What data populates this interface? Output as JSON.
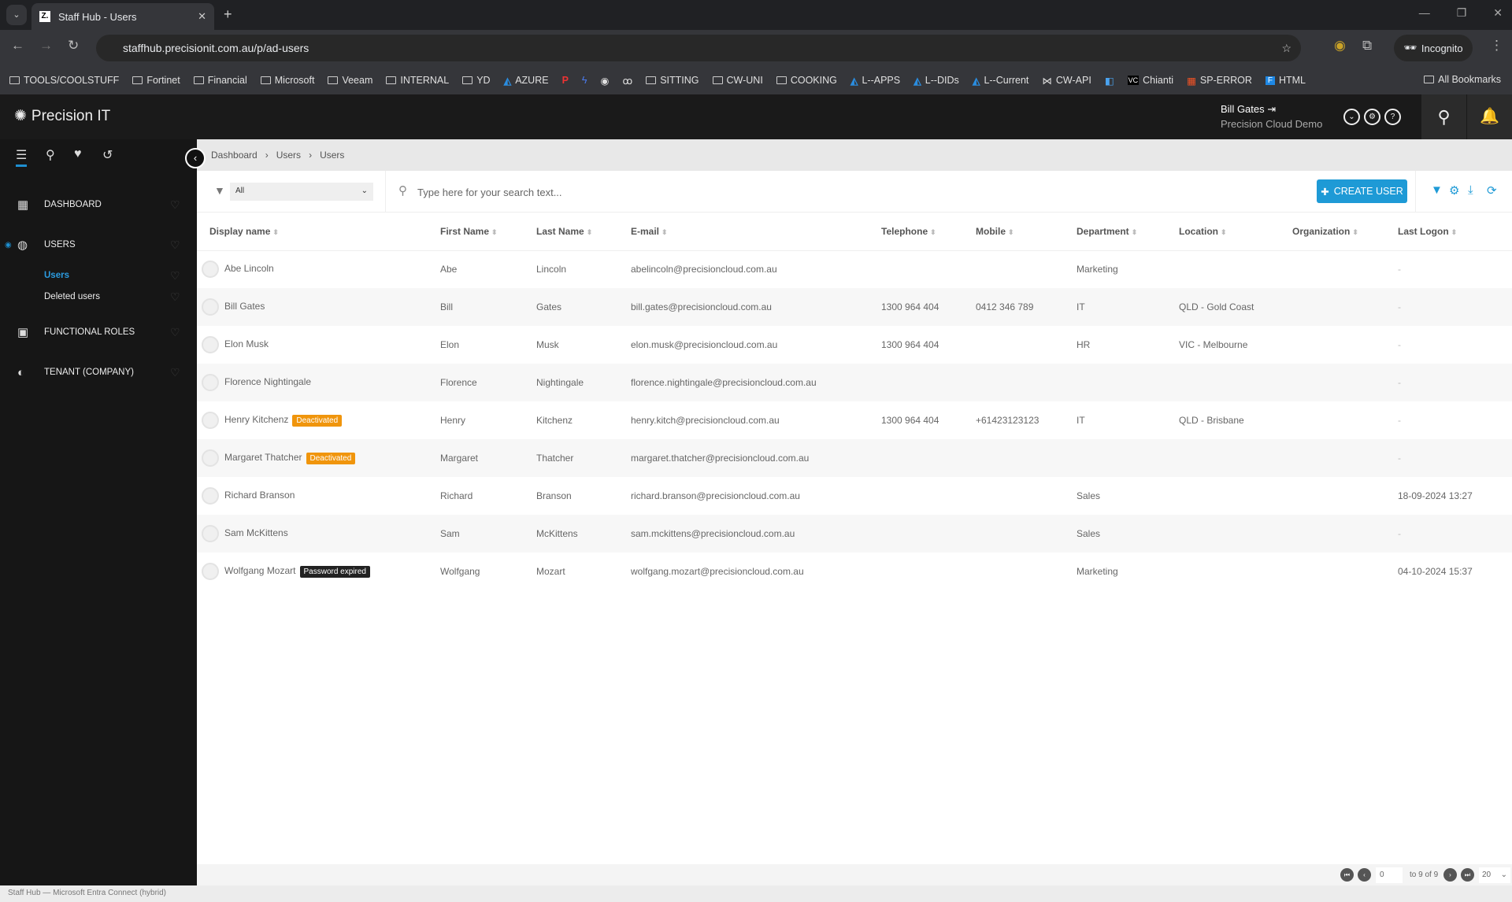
{
  "browser": {
    "tab_title": "Staff Hub - Users",
    "tab_favicon": "Z.",
    "url": "staffhub.precisionit.com.au/p/ad-users",
    "profile": "Incognito",
    "bookmarks": [
      {
        "label": "TOOLS/COOLSTUFF",
        "icon": "folder"
      },
      {
        "label": "Fortinet",
        "icon": "folder"
      },
      {
        "label": "Financial",
        "icon": "folder"
      },
      {
        "label": "Microsoft",
        "icon": "folder"
      },
      {
        "label": "Veeam",
        "icon": "folder"
      },
      {
        "label": "INTERNAL",
        "icon": "folder"
      },
      {
        "label": "YD",
        "icon": "folder"
      },
      {
        "label": "AZURE",
        "icon": "azure"
      },
      {
        "label": "",
        "icon": "red-p"
      },
      {
        "label": "",
        "icon": "bolt"
      },
      {
        "label": "",
        "icon": "globe"
      },
      {
        "label": "",
        "icon": "abc"
      },
      {
        "label": "SITTING",
        "icon": "folder"
      },
      {
        "label": "CW-UNI",
        "icon": "folder"
      },
      {
        "label": "COOKING",
        "icon": "folder"
      },
      {
        "label": "L--APPS",
        "icon": "azure"
      },
      {
        "label": "L--DIDs",
        "icon": "azure"
      },
      {
        "label": "L--Current",
        "icon": "azure"
      },
      {
        "label": "CW-API",
        "icon": "link"
      },
      {
        "label": "",
        "icon": "ai"
      },
      {
        "label": "Chianti",
        "icon": "vc"
      },
      {
        "label": "SP-ERROR",
        "icon": "ms"
      },
      {
        "label": "HTML",
        "icon": "f"
      }
    ],
    "all_bookmarks": "All Bookmarks"
  },
  "app": {
    "brand": "Precision IT",
    "user_name": "Bill Gates",
    "tenant": "Precision Cloud Demo"
  },
  "sidebar": {
    "items": [
      {
        "label": "DASHBOARD",
        "icon": "grid-icon"
      },
      {
        "label": "USERS",
        "icon": "user-icon"
      },
      {
        "label": "Users"
      },
      {
        "label": "Deleted users"
      },
      {
        "label": "FUNCTIONAL ROLES",
        "icon": "badge-icon"
      },
      {
        "label": "TENANT (COMPANY)",
        "icon": "compass-icon"
      }
    ]
  },
  "breadcrumb": [
    "Dashboard",
    "Users",
    "Users"
  ],
  "toolbar": {
    "filter_value": "All",
    "search_placeholder": "Type here for your search text...",
    "create_label": "CREATE USER"
  },
  "table": {
    "columns": [
      "Display name",
      "First Name",
      "Last Name",
      "E-mail",
      "Telephone",
      "Mobile",
      "Department",
      "Location",
      "Organization",
      "Last Logon"
    ],
    "rows": [
      {
        "display": "Abe Lincoln",
        "badge": "",
        "first": "Abe",
        "last": "Lincoln",
        "email": "abelincoln@precisioncloud.com.au",
        "tel": "",
        "mobile": "",
        "dept": "Marketing",
        "loc": "",
        "org": "",
        "logon": "-"
      },
      {
        "display": "Bill Gates",
        "badge": "",
        "first": "Bill",
        "last": "Gates",
        "email": "bill.gates@precisioncloud.com.au",
        "tel": "1300 964 404",
        "mobile": "0412 346 789",
        "dept": "IT",
        "loc": "QLD - Gold Coast",
        "org": "",
        "logon": "-"
      },
      {
        "display": "Elon Musk",
        "badge": "",
        "first": "Elon",
        "last": "Musk",
        "email": "elon.musk@precisioncloud.com.au",
        "tel": "1300 964 404",
        "mobile": "",
        "dept": "HR",
        "loc": "VIC - Melbourne",
        "org": "",
        "logon": "-"
      },
      {
        "display": "Florence Nightingale",
        "badge": "",
        "first": "Florence",
        "last": "Nightingale",
        "email": "florence.nightingale@precisioncloud.com.au",
        "tel": "",
        "mobile": "",
        "dept": "",
        "loc": "",
        "org": "",
        "logon": "-"
      },
      {
        "display": "Henry Kitchenz",
        "badge": "Deactivated",
        "first": "Henry",
        "last": "Kitchenz",
        "email": "henry.kitch@precisioncloud.com.au",
        "tel": "1300 964 404",
        "mobile": "+61423123123",
        "dept": "IT",
        "loc": "QLD - Brisbane",
        "org": "",
        "logon": "-"
      },
      {
        "display": "Margaret Thatcher",
        "badge": "Deactivated",
        "first": "Margaret",
        "last": "Thatcher",
        "email": "margaret.thatcher@precisioncloud.com.au",
        "tel": "",
        "mobile": "",
        "dept": "",
        "loc": "",
        "org": "",
        "logon": "-"
      },
      {
        "display": "Richard Branson",
        "badge": "",
        "first": "Richard",
        "last": "Branson",
        "email": "richard.branson@precisioncloud.com.au",
        "tel": "",
        "mobile": "",
        "dept": "Sales",
        "loc": "",
        "org": "",
        "logon": "18-09-2024 13:27"
      },
      {
        "display": "Sam McKittens",
        "badge": "",
        "first": "Sam",
        "last": "McKittens",
        "email": "sam.mckittens@precisioncloud.com.au",
        "tel": "",
        "mobile": "",
        "dept": "Sales",
        "loc": "",
        "org": "",
        "logon": "-"
      },
      {
        "display": "Wolfgang Mozart",
        "badge": "Password expired",
        "first": "Wolfgang",
        "last": "Mozart",
        "email": "wolfgang.mozart@precisioncloud.com.au",
        "tel": "",
        "mobile": "",
        "dept": "Marketing",
        "loc": "",
        "org": "",
        "logon": "04-10-2024 15:37"
      }
    ]
  },
  "badge_colors": {
    "Deactivated": "#f0950c",
    "Password expired": "#222222"
  },
  "pagination": {
    "page_input": "0",
    "range_text": "to 9 of 9",
    "page_size": "20"
  },
  "status_bar": "Staff Hub — Microsoft Entra Connect (hybrid)",
  "colors": {
    "accent": "#1e9ad6",
    "sidebar_bg": "#161616"
  }
}
